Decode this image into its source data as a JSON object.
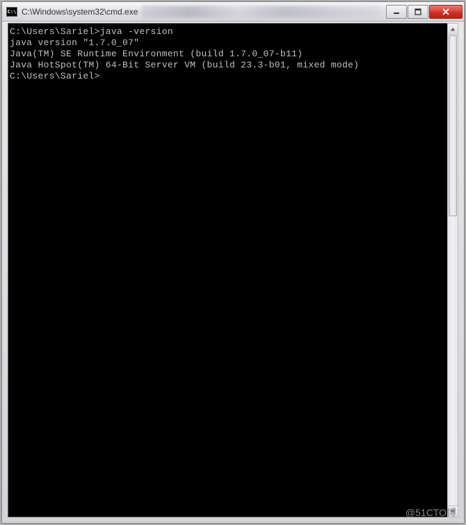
{
  "window": {
    "icon_text": "C:\\",
    "title": "C:\\Windows\\system32\\cmd.exe"
  },
  "terminal": {
    "lines": [
      "",
      "C:\\Users\\Sariel>java -version",
      "java version \"1.7.0_07\"",
      "Java(TM) SE Runtime Environment (build 1.7.0_07-b11)",
      "Java HotSpot(TM) 64-Bit Server VM (build 23.3-b01, mixed mode)",
      "",
      "C:\\Users\\Sariel>"
    ]
  },
  "watermark": "@51CTO博"
}
